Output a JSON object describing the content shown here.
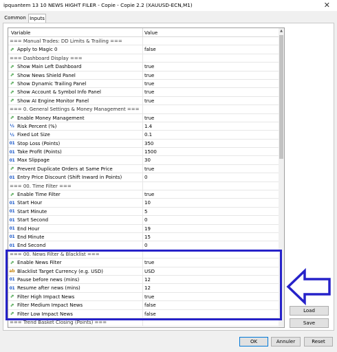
{
  "window": {
    "title": "ipquantem 13 10 NEWS HIGHT FILER - Copie - Copie 2.2 (XAUUSD-ECN,M1)",
    "close_glyph": "✕"
  },
  "tabs": [
    {
      "label": "Common",
      "active": false
    },
    {
      "label": "Inputs",
      "active": true
    }
  ],
  "grid": {
    "header": {
      "variable": "Variable",
      "value": "Value"
    },
    "rows": [
      {
        "type": "section",
        "name": "=== Manual Trades: DD Limits & Trailing ===",
        "value": ""
      },
      {
        "type": "bool",
        "icon": "boolean-icon",
        "name": "Apply to Magic 0",
        "value": "false"
      },
      {
        "type": "section",
        "name": "=== Dashboard Display ===",
        "value": ""
      },
      {
        "type": "bool",
        "icon": "boolean-icon",
        "name": "Show Main Left Dashboard",
        "value": "true"
      },
      {
        "type": "bool",
        "icon": "boolean-icon",
        "name": "Show News Shield Panel",
        "value": "true"
      },
      {
        "type": "bool",
        "icon": "boolean-icon",
        "name": "Show Dynamic Trailing Panel",
        "value": "true"
      },
      {
        "type": "bool",
        "icon": "boolean-icon",
        "name": "Show Account & Symbol Info Panel",
        "value": "true"
      },
      {
        "type": "bool",
        "icon": "boolean-icon",
        "name": "Show AI Engine Monitor Panel",
        "value": "true"
      },
      {
        "type": "section",
        "name": "=== 0. General Settings & Money Management ===",
        "value": ""
      },
      {
        "type": "bool",
        "icon": "boolean-icon",
        "name": "Enable Money Management",
        "value": "true"
      },
      {
        "type": "dbl",
        "icon": "double-icon",
        "name": "Risk Percent (%)",
        "value": "1.4"
      },
      {
        "type": "dbl",
        "icon": "double-icon",
        "name": "Fixed Lot Size",
        "value": "0.1"
      },
      {
        "type": "int",
        "icon": "integer-icon",
        "name": "Stop Loss (Points)",
        "value": "350"
      },
      {
        "type": "int",
        "icon": "integer-icon",
        "name": "Take Profit (Points)",
        "value": "1500"
      },
      {
        "type": "int",
        "icon": "integer-icon",
        "name": "Max Slippage",
        "value": "30"
      },
      {
        "type": "bool",
        "icon": "boolean-icon",
        "name": "Prevent Duplicate Orders at Same Price",
        "value": "true"
      },
      {
        "type": "int",
        "icon": "integer-icon",
        "name": "Entry Price Discount (Shift Inward in Points)",
        "value": "0"
      },
      {
        "type": "section",
        "name": "=== 00. Time Filter ===",
        "value": ""
      },
      {
        "type": "bool",
        "icon": "boolean-icon",
        "name": "Enable Time Filter",
        "value": "true"
      },
      {
        "type": "int",
        "icon": "integer-icon",
        "name": "Start Hour",
        "value": "10"
      },
      {
        "type": "int",
        "icon": "integer-icon",
        "name": "Start Minute",
        "value": "5"
      },
      {
        "type": "int",
        "icon": "integer-icon",
        "name": "Start Second",
        "value": "0"
      },
      {
        "type": "int",
        "icon": "integer-icon",
        "name": "End Hour",
        "value": "19"
      },
      {
        "type": "int",
        "icon": "integer-icon",
        "name": "End Minute",
        "value": "15"
      },
      {
        "type": "int",
        "icon": "integer-icon",
        "name": "End Second",
        "value": "0"
      },
      {
        "type": "section",
        "name": "=== 00. News Filter & Blacklist ===",
        "value": ""
      },
      {
        "type": "bool",
        "icon": "boolean-icon",
        "name": "Enable News Filter",
        "value": "true"
      },
      {
        "type": "str",
        "icon": "string-icon",
        "name": "Blacklist Target Currency (e.g. USD)",
        "value": "USD"
      },
      {
        "type": "int",
        "icon": "integer-icon",
        "name": "Pause before news (mins)",
        "value": "12"
      },
      {
        "type": "int",
        "icon": "integer-icon",
        "name": "Resume after news (mins)",
        "value": "12"
      },
      {
        "type": "bool",
        "icon": "boolean-icon",
        "name": "Filter High Impact News",
        "value": "true"
      },
      {
        "type": "bool",
        "icon": "boolean-icon",
        "name": "Filter Medium Impact News",
        "value": "false"
      },
      {
        "type": "bool",
        "icon": "boolean-icon",
        "name": "Filter Low Impact News",
        "value": "false"
      },
      {
        "type": "section",
        "name": "=== Trend Basket Closing (Points) ===",
        "value": ""
      }
    ]
  },
  "icon_glyphs": {
    "bool": "⇗",
    "int": "01",
    "dbl": "½",
    "str": "ab"
  },
  "side_buttons": {
    "load": "Load",
    "save": "Save"
  },
  "bottom_buttons": {
    "ok": "OK",
    "annuler": "Annuler",
    "reset": "Reset"
  },
  "annotation": {
    "box_color": "#2622c9",
    "arrow_color": "#2622c9"
  }
}
